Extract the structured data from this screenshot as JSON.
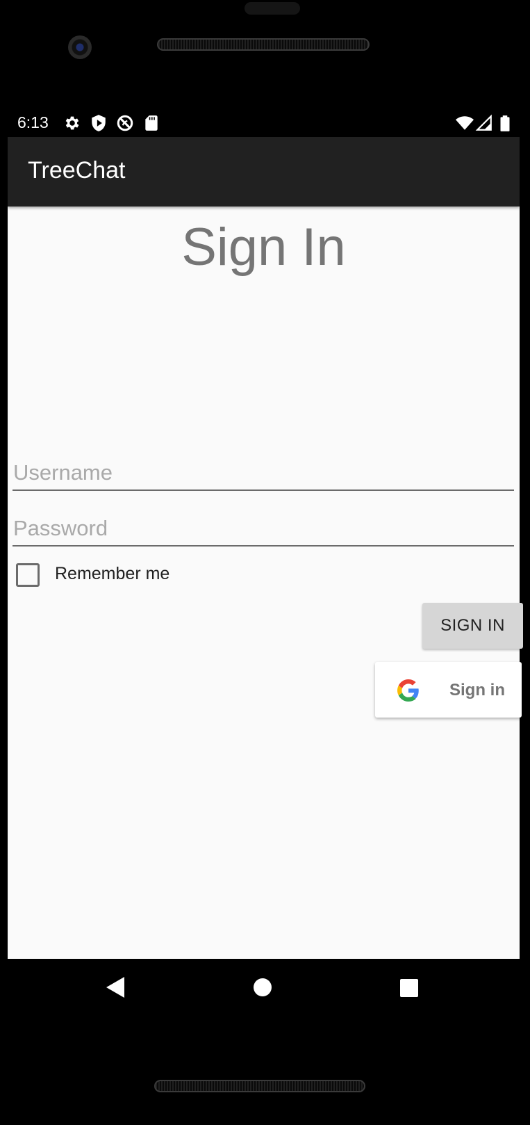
{
  "status_bar": {
    "time": "6:13",
    "left_icons": [
      "gear-icon",
      "shield-play-icon",
      "blocked-circle-icon",
      "sd-card-icon"
    ],
    "right_icons": [
      "wifi-icon",
      "cell-signal-icon",
      "battery-icon"
    ]
  },
  "app_bar": {
    "title": "TreeChat"
  },
  "form": {
    "heading": "Sign In",
    "username": {
      "value": "",
      "placeholder": "Username"
    },
    "password": {
      "value": "",
      "placeholder": "Password"
    },
    "remember_label": "Remember me",
    "remember_checked": false,
    "sign_in_label": "SIGN IN",
    "google_sign_in_label": "Sign in"
  },
  "nav_bar": {
    "buttons": [
      "back-icon",
      "home-icon",
      "recents-icon"
    ]
  },
  "colors": {
    "app_bar_bg": "#212121",
    "screen_bg": "#fafafa",
    "heading": "#757575",
    "button_bg": "#d6d6d6"
  }
}
